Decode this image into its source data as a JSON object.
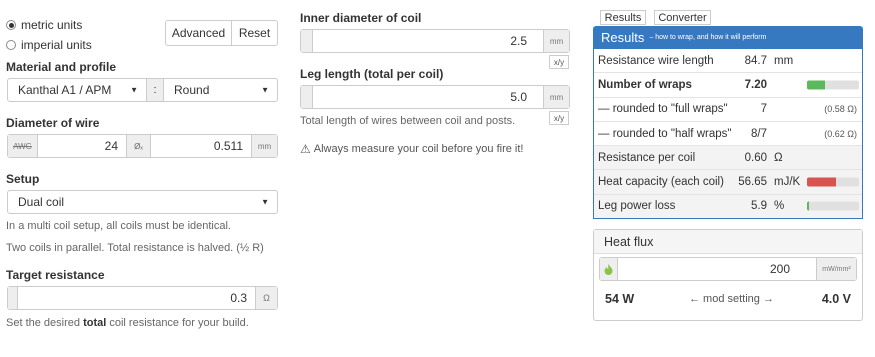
{
  "units": {
    "metric": "metric units",
    "imperial": "imperial units",
    "selected": "metric"
  },
  "buttons": {
    "advanced": "Advanced",
    "reset": "Reset"
  },
  "material": {
    "label": "Material and profile",
    "value": "Kanthal A1 / APM",
    "separator": ":",
    "profile": "Round"
  },
  "diameter": {
    "label": "Diameter of wire",
    "awg_label": "AWG",
    "awg_value": "24",
    "diam_symbol": "Øₓ",
    "mm_value": "0.511",
    "unit": "mm"
  },
  "setup": {
    "label": "Setup",
    "value": "Dual coil",
    "help1": "In a multi coil setup, all coils must be identical.",
    "help2": "Two coils in parallel. Total resistance is halved. (½ R)"
  },
  "target": {
    "label": "Target resistance",
    "value": "0.3",
    "unit": "Ω",
    "help_pre": "Set the desired ",
    "help_bold": "total",
    "help_post": " coil resistance for your build."
  },
  "inner": {
    "label": "Inner diameter of coil",
    "value": "2.5",
    "unit": "mm",
    "toggle": "x/y"
  },
  "leg": {
    "label": "Leg length (total per coil)",
    "value": "5.0",
    "unit": "mm",
    "toggle": "x/y",
    "help": "Total length of wires between coil and posts."
  },
  "warning": {
    "icon": "warning-icon",
    "text": "Always measure your coil before you fire it!"
  },
  "tabs": {
    "results": "Results",
    "converter": "Converter",
    "active": "results"
  },
  "results": {
    "title": "Results",
    "subtitle": "– how to wrap, and how it will perform",
    "rows": [
      {
        "name": "Resistance wire length",
        "value": "84.7",
        "unit": "mm",
        "extra": ""
      },
      {
        "name": "Number of wraps",
        "value": "7.20",
        "unit": "",
        "extra": "",
        "bar": 0.35,
        "bar_color": "#5cb85c"
      },
      {
        "name": "— rounded to \"full wraps\"",
        "value": "7",
        "unit": "",
        "extra": "(0.58 Ω)"
      },
      {
        "name": "— rounded to \"half wraps\"",
        "value": "8/7",
        "unit": "",
        "extra": "(0.62 Ω)"
      },
      {
        "name": "Resistance per coil",
        "value": "0.60",
        "unit": "Ω",
        "extra": ""
      },
      {
        "name": "Heat capacity (each coil)",
        "value": "56.65",
        "unit": "mJ/K",
        "extra": "",
        "bar": 0.55,
        "bar_color": "#d9534f"
      },
      {
        "name": "Leg power loss",
        "value": "5.9",
        "unit": "%",
        "extra": "",
        "bar": 0.04,
        "bar_color": "#5cb85c"
      }
    ]
  },
  "heatflux": {
    "title": "Heat flux",
    "value": "200",
    "unit": "mW/mm²",
    "watts": "54 W",
    "mod": "← mod setting →",
    "volts": "4.0 V",
    "icon": "flame-icon"
  }
}
